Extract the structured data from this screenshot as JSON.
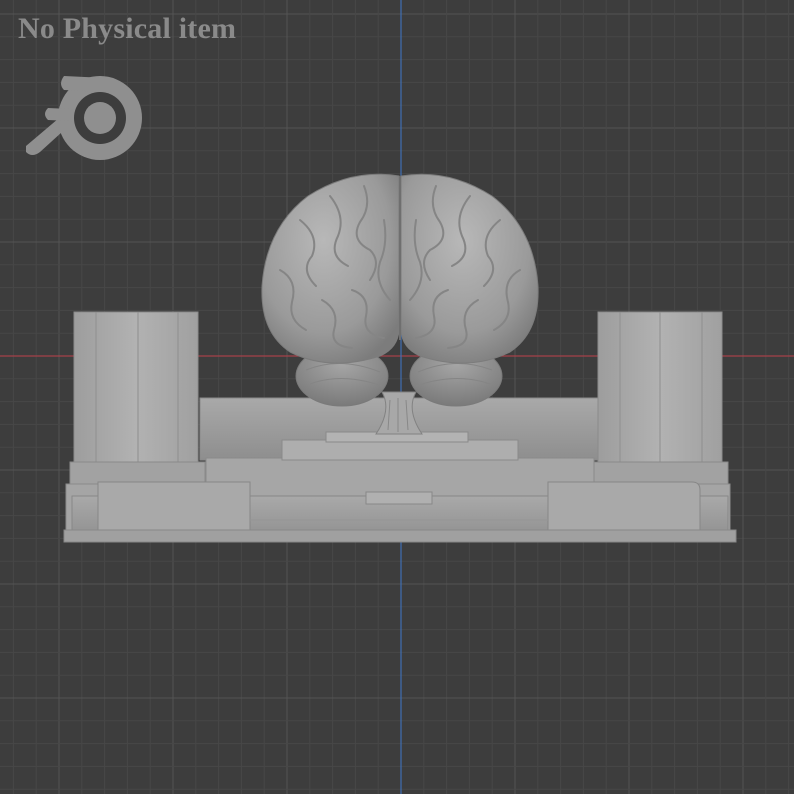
{
  "watermark": {
    "text": "No Physical item",
    "logo": "blender-logo"
  },
  "viewport": {
    "background": "#3d3d3d",
    "grid_minor_color": "#474747",
    "grid_major_color": "#545454",
    "x_axis_color": "#a5414a",
    "z_axis_color": "#3f6fb3"
  },
  "model": {
    "object": "brain-on-stand",
    "material_color": "#9c9c9c"
  }
}
